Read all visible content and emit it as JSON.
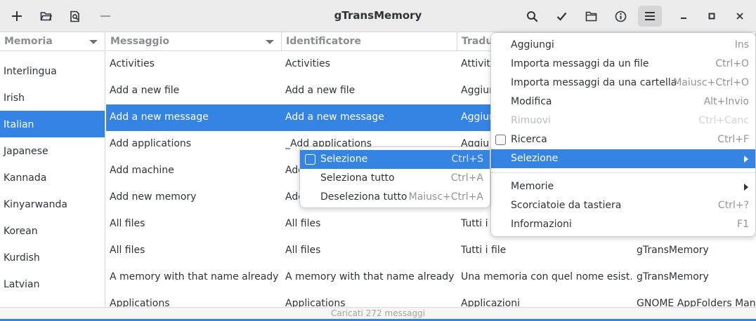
{
  "window": {
    "title": "gTransMemory",
    "status": "Caricati 272 messaggi"
  },
  "toolbar": {
    "left": [
      {
        "icon": "plus-icon"
      },
      {
        "icon": "open-folder-icon"
      },
      {
        "icon": "document-search-icon"
      },
      {
        "icon": "minus-icon",
        "disabled": true
      }
    ],
    "right": [
      {
        "icon": "search-icon"
      },
      {
        "icon": "checkmark-icon"
      },
      {
        "icon": "folder-icon"
      },
      {
        "icon": "info-icon"
      },
      {
        "icon": "hamburger-menu-icon",
        "pressed": true
      }
    ],
    "window_controls": [
      {
        "icon": "minimize-icon"
      },
      {
        "icon": "maximize-icon"
      },
      {
        "icon": "close-icon"
      }
    ]
  },
  "columns": {
    "memoria": "Memoria",
    "messaggio": "Messaggio",
    "identificatore": "Identificatore",
    "traduzione": "Tradu"
  },
  "languages": [
    {
      "name": "Interlingua",
      "selected": false
    },
    {
      "name": "Irish",
      "selected": false
    },
    {
      "name": "Italian",
      "selected": true
    },
    {
      "name": "Japanese",
      "selected": false
    },
    {
      "name": "Kannada",
      "selected": false
    },
    {
      "name": "Kinyarwanda",
      "selected": false
    },
    {
      "name": "Korean",
      "selected": false
    },
    {
      "name": "Kurdish",
      "selected": false
    },
    {
      "name": "Latvian",
      "selected": false
    }
  ],
  "messages": [
    {
      "message": "Activities",
      "identifier": "Activities",
      "translation": "Attività",
      "memory": ""
    },
    {
      "message": "Add a new file",
      "identifier": "Add a new file",
      "translation": "Aggiun",
      "memory": ""
    },
    {
      "message": "Add a new message",
      "identifier": "Add a new message",
      "translation": "Aggiun",
      "memory": "",
      "selected": true
    },
    {
      "message": "Add applications",
      "identifier": "_Add applications",
      "translation": "Aggiu",
      "memory": ""
    },
    {
      "message": "Add machine",
      "identifier": "Add",
      "translation": "",
      "memory": ""
    },
    {
      "message": "Add new memory",
      "identifier": "Add",
      "translation": "",
      "memory": ""
    },
    {
      "message": "All files",
      "identifier": "All files",
      "translation": "Tutti i f",
      "memory": ""
    },
    {
      "message": "All files",
      "identifier": "All files",
      "translation": "Tutti i file",
      "memory": "gTransMemory"
    },
    {
      "message": "A memory with that name already …",
      "identifier": "A memory with that name already exis",
      "translation": "Una memoria con quel nome esist…",
      "memory": "gTransMemory"
    },
    {
      "message": "Applications",
      "identifier": "Applications",
      "translation": "Applicazioni",
      "memory": "GNOME AppFolders Mana"
    }
  ],
  "main_menu": {
    "items": [
      {
        "label": "Aggiungi",
        "accel": "Ins"
      },
      {
        "label": "Importa messaggi da un file",
        "accel": "Ctrl+O"
      },
      {
        "label": "Importa messaggi da una cartella",
        "accel": "Maiusc+Ctrl+O"
      },
      {
        "label": "Modifica",
        "accel": "Alt+Invio"
      },
      {
        "label": "Rimuovi",
        "accel": "Ctrl+Canc",
        "disabled": true
      },
      {
        "label": "Ricerca",
        "accel": "Ctrl+F",
        "checkbox": true,
        "checked": false
      },
      {
        "label": "Selezione",
        "accel": "",
        "submenu": true,
        "highlighted": true
      },
      {
        "label": "Memorie",
        "accel": "",
        "submenu": true
      },
      {
        "label": "Scorciatoie da tastiera",
        "accel": "Ctrl+?"
      },
      {
        "label": "Informazioni",
        "accel": "F1"
      }
    ]
  },
  "selection_submenu": {
    "items": [
      {
        "label": "Selezione",
        "accel": "Ctrl+S",
        "checkbox": true,
        "checked": false,
        "highlighted": true
      },
      {
        "label": "Seleziona tutto",
        "accel": "Ctrl+A"
      },
      {
        "label": "Deseleziona tutto",
        "accel": "Maiusc+Ctrl+A"
      }
    ]
  }
}
